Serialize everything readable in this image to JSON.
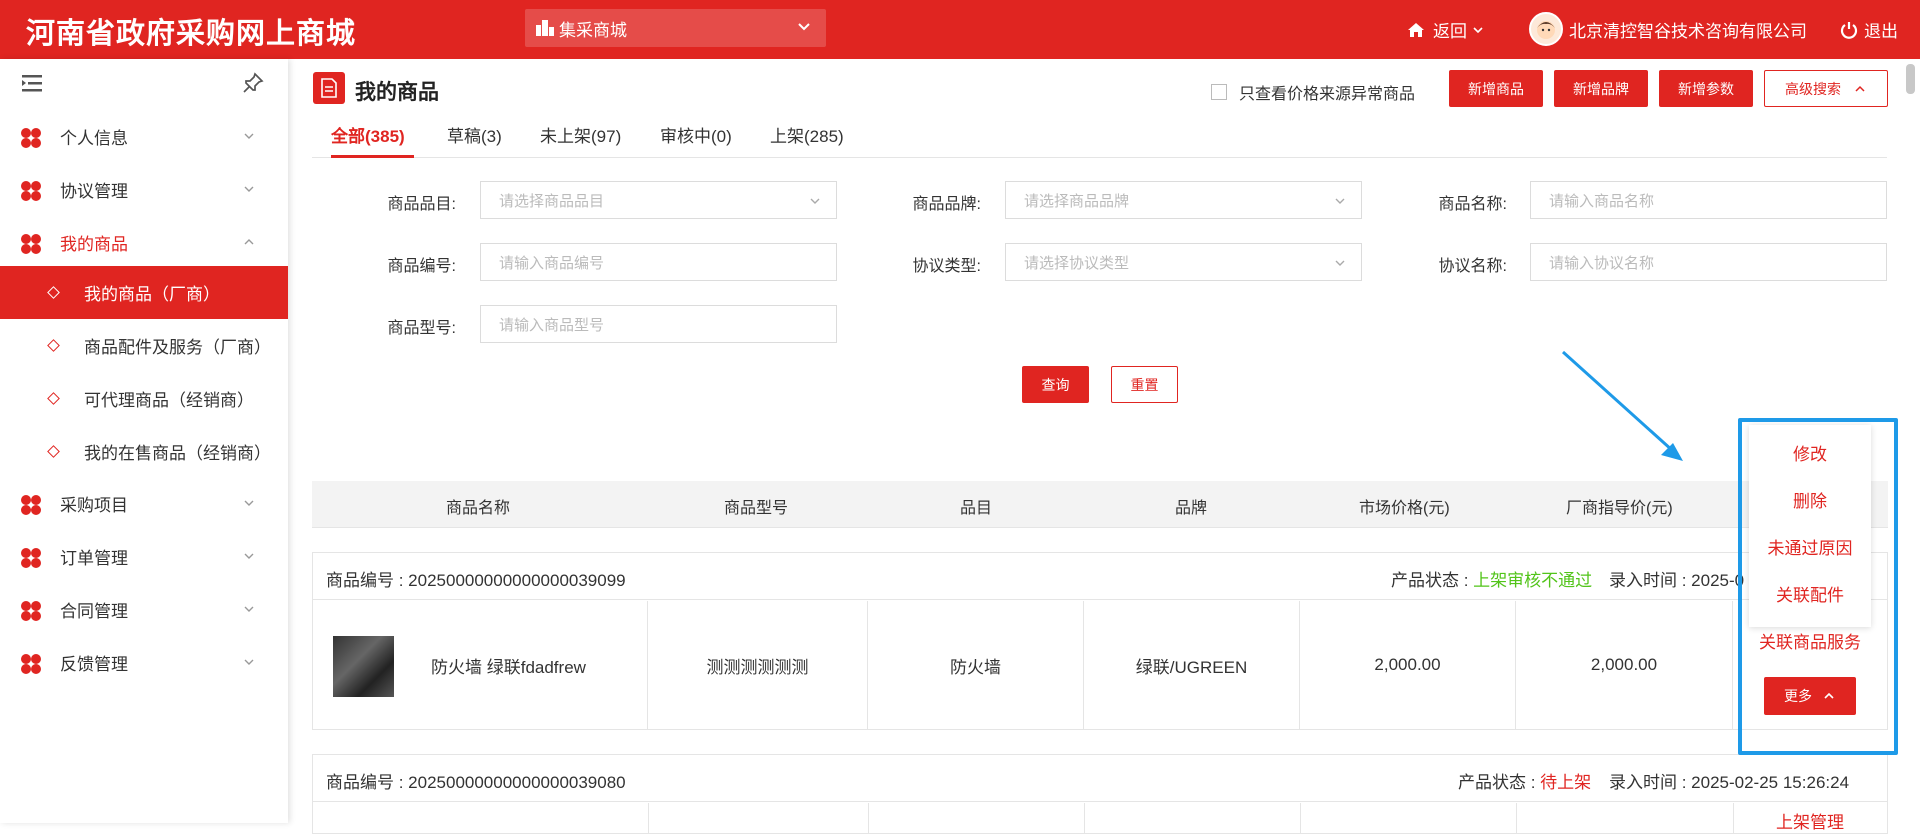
{
  "header": {
    "logo": "河南省政府采购网上商城",
    "mall_select": "集采商城",
    "back": "返回",
    "company": "北京清控智谷技术咨询有限公司",
    "logout": "退出"
  },
  "sidebar": {
    "menus": [
      {
        "label": "个人信息"
      },
      {
        "label": "协议管理"
      },
      {
        "label": "我的商品"
      },
      {
        "label": "采购项目"
      },
      {
        "label": "订单管理"
      },
      {
        "label": "合同管理"
      },
      {
        "label": "反馈管理"
      }
    ],
    "submenus": [
      {
        "label": "我的商品（厂商）"
      },
      {
        "label": "商品配件及服务（厂商）"
      },
      {
        "label": "可代理商品（经销商）"
      },
      {
        "label": "我的在售商品（经销商）"
      }
    ]
  },
  "page": {
    "title": "我的商品",
    "abnormal_check": "只查看价格来源异常商品",
    "btn_add_goods": "新增商品",
    "btn_add_brand": "新增品牌",
    "btn_add_param": "新增参数",
    "btn_adv_search": "高级搜索"
  },
  "tabs": [
    {
      "label": "全部(385)"
    },
    {
      "label": "草稿(3)"
    },
    {
      "label": "未上架(97)"
    },
    {
      "label": "审核中(0)"
    },
    {
      "label": "上架(285)"
    }
  ],
  "filters": {
    "category_label": "商品品目:",
    "category_ph": "请选择商品品目",
    "brand_label": "商品品牌:",
    "brand_ph": "请选择商品品牌",
    "name_label": "商品名称:",
    "name_ph": "请输入商品名称",
    "code_label": "商品编号:",
    "code_ph": "请输入商品编号",
    "agreement_type_label": "协议类型:",
    "agreement_type_ph": "请选择协议类型",
    "agreement_name_label": "协议名称:",
    "agreement_name_ph": "请输入协议名称",
    "model_label": "商品型号:",
    "model_ph": "请输入商品型号",
    "query": "查询",
    "reset": "重置"
  },
  "table": {
    "headers": [
      "商品名称",
      "商品型号",
      "品目",
      "品牌",
      "市场价格(元)",
      "厂商指导价(元)"
    ]
  },
  "items": [
    {
      "code": "商品编号 : 20250000000000000039099",
      "status_label": "产品状态 : ",
      "status": "上架审核不通过",
      "status_color": "#52c41a",
      "time": "录入时间 : 2025-0",
      "name": "防火墙 绿联fdadfrew",
      "model": "测测测测测测",
      "category": "防火墙",
      "brand": "绿联/UGREEN",
      "market_price": "2,000.00",
      "guide_price": "2,000.00"
    },
    {
      "code": "商品编号 : 20250000000000000039080",
      "status_label": "产品状态 : ",
      "status": "待上架",
      "status_color": "#e02521",
      "time": "录入时间 : 2025-02-25 15:26:24",
      "partial_action": "上架管理"
    }
  ],
  "popup": {
    "items": [
      "修改",
      "删除",
      "未通过原因",
      "关联配件",
      "关联商品服务"
    ],
    "more": "更多"
  },
  "colors": {
    "brand_red": "#e02521",
    "highlight_blue": "#1e9ae8"
  }
}
